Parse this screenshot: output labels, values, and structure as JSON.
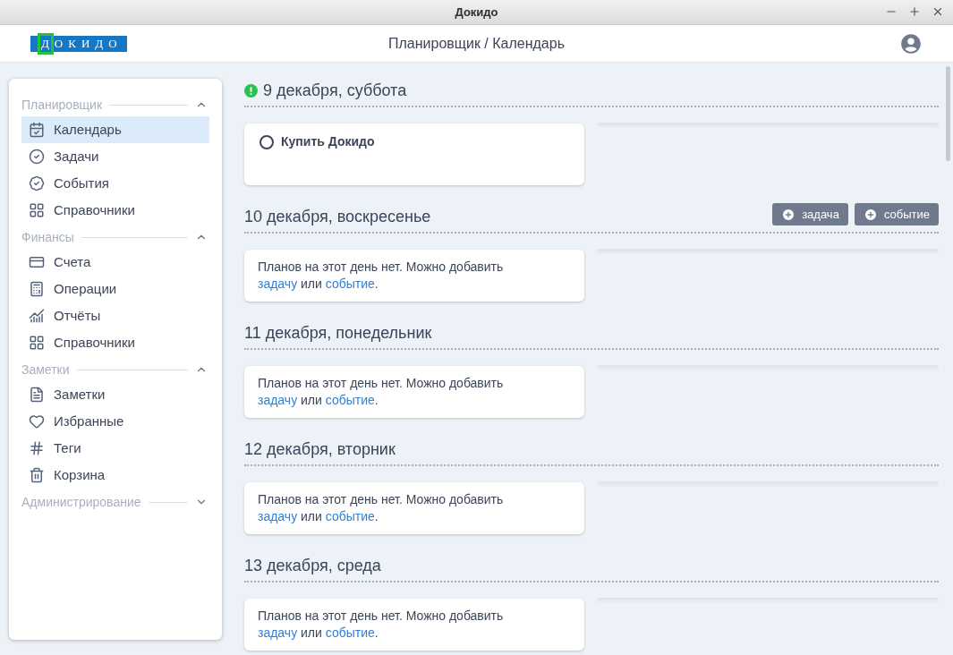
{
  "window": {
    "title": "Докидо"
  },
  "header": {
    "logo": "ДОКИДО",
    "breadcrumb": "Планировщик / Календарь"
  },
  "sidebar": {
    "sections": [
      {
        "title": "Планировщик",
        "expanded": true,
        "items": [
          {
            "label": "Календарь",
            "selected": true
          },
          {
            "label": "Задачи",
            "selected": false
          },
          {
            "label": "События",
            "selected": false
          },
          {
            "label": "Справочники",
            "selected": false
          }
        ]
      },
      {
        "title": "Финансы",
        "expanded": true,
        "items": [
          {
            "label": "Счета",
            "selected": false
          },
          {
            "label": "Операции",
            "selected": false
          },
          {
            "label": "Отчёты",
            "selected": false
          },
          {
            "label": "Справочники",
            "selected": false
          }
        ]
      },
      {
        "title": "Заметки",
        "expanded": true,
        "items": [
          {
            "label": "Заметки",
            "selected": false
          },
          {
            "label": "Избранные",
            "selected": false
          },
          {
            "label": "Теги",
            "selected": false
          },
          {
            "label": "Корзина",
            "selected": false
          }
        ]
      },
      {
        "title": "Администрирование",
        "expanded": false
      }
    ]
  },
  "days": [
    {
      "date": "9 декабря, суббота",
      "alert": true,
      "tasks": [
        {
          "title": "Купить Докидо",
          "done": false
        }
      ]
    },
    {
      "date": "10 декабря, воскресенье",
      "alert": false,
      "actions": [
        "задача",
        "событие"
      ],
      "empty": {
        "before": "Планов на этот день нет. Можно добавить",
        "task_link": "задачу",
        "middle": "или",
        "event_link": "событие",
        "after": "."
      }
    },
    {
      "date": "11 декабря, понедельник",
      "alert": false,
      "empty": {
        "before": "Планов на этот день нет. Можно добавить",
        "task_link": "задачу",
        "middle": "или",
        "event_link": "событие",
        "after": "."
      }
    },
    {
      "date": "12 декабря, вторник",
      "alert": false,
      "empty": {
        "before": "Планов на этот день нет. Можно добавить",
        "task_link": "задачу",
        "middle": "или",
        "event_link": "событие",
        "after": "."
      }
    },
    {
      "date": "13 декабря, среда",
      "alert": false,
      "empty": {
        "before": "Планов на этот день нет. Можно добавить",
        "task_link": "задачу",
        "middle": "или",
        "event_link": "событие",
        "after": "."
      }
    }
  ]
}
